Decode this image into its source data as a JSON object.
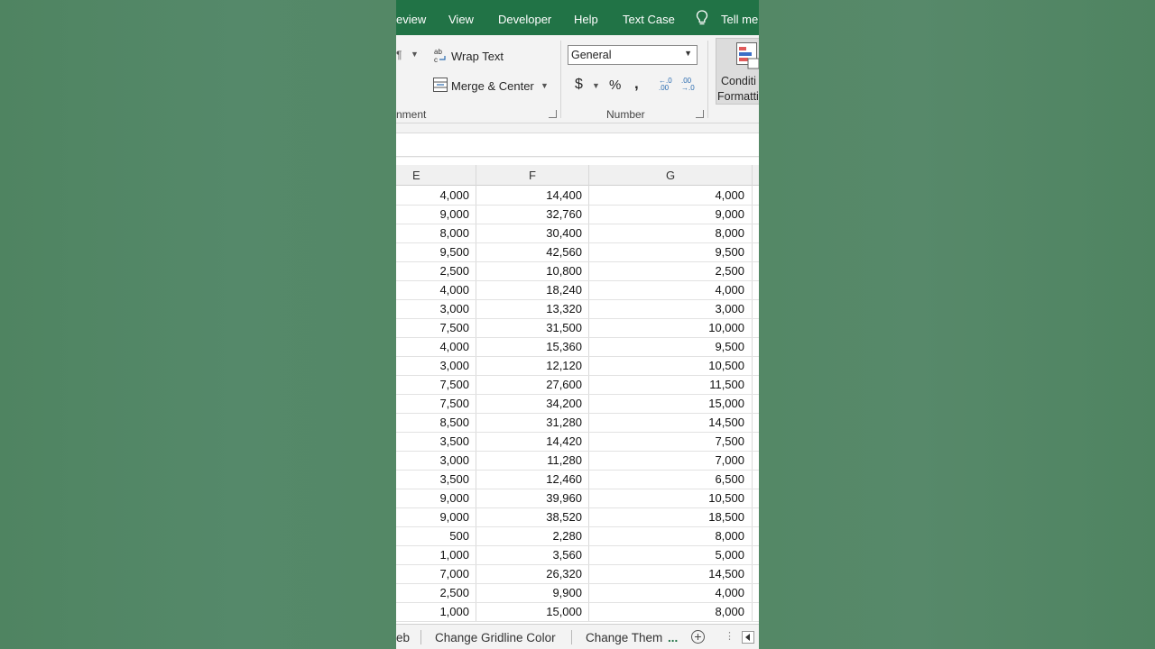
{
  "tabs": [
    "eview",
    "View",
    "Developer",
    "Help",
    "Text Case",
    "Tell me"
  ],
  "ribbon": {
    "paragraph_mark": "¶",
    "wrap_text": "Wrap Text",
    "merge_center": "Merge & Center",
    "alignment_label": "nment",
    "number_format": "General",
    "currency": "$",
    "percent": "%",
    "comma": ",",
    "increase_decimal": "←.0 .00",
    "decrease_decimal": ".00 →.0",
    "number_label": "Number",
    "conditional_formatting_line1": "Conditi",
    "conditional_formatting_line2": "Formatti"
  },
  "columns": [
    "E",
    "F",
    "G"
  ],
  "rows": [
    [
      "4,000",
      "14,400",
      "4,000"
    ],
    [
      "9,000",
      "32,760",
      "9,000"
    ],
    [
      "8,000",
      "30,400",
      "8,000"
    ],
    [
      "9,500",
      "42,560",
      "9,500"
    ],
    [
      "2,500",
      "10,800",
      "2,500"
    ],
    [
      "4,000",
      "18,240",
      "4,000"
    ],
    [
      "3,000",
      "13,320",
      "3,000"
    ],
    [
      "7,500",
      "31,500",
      "10,000"
    ],
    [
      "4,000",
      "15,360",
      "9,500"
    ],
    [
      "3,000",
      "12,120",
      "10,500"
    ],
    [
      "7,500",
      "27,600",
      "11,500"
    ],
    [
      "7,500",
      "34,200",
      "15,000"
    ],
    [
      "8,500",
      "31,280",
      "14,500"
    ],
    [
      "3,500",
      "14,420",
      "7,500"
    ],
    [
      "3,000",
      "11,280",
      "7,000"
    ],
    [
      "3,500",
      "12,460",
      "6,500"
    ],
    [
      "9,000",
      "39,960",
      "10,500"
    ],
    [
      "9,000",
      "38,520",
      "18,500"
    ],
    [
      "500",
      "2,280",
      "8,000"
    ],
    [
      "1,000",
      "3,560",
      "5,000"
    ],
    [
      "7,000",
      "26,320",
      "14,500"
    ],
    [
      "2,500",
      "9,900",
      "4,000"
    ],
    [
      "1,000",
      "15,000",
      "8,000"
    ]
  ],
  "sheet_tabs": [
    "eb",
    "Change Gridline Color",
    "Change Them"
  ],
  "sheet_tabs_more": "...",
  "add_sheet": "+",
  "colors": {
    "accent": "#217346",
    "background": "#528660"
  }
}
